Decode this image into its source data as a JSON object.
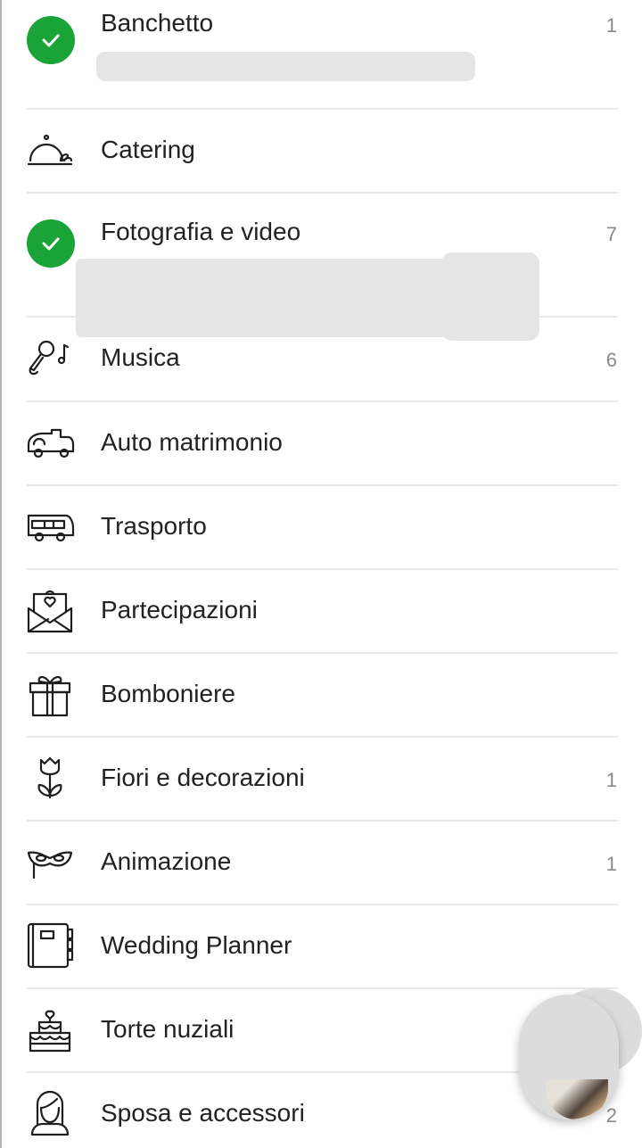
{
  "categories": [
    {
      "label": "Banchetto",
      "count": "1",
      "icon": "check-circle-icon",
      "completed": true
    },
    {
      "label": "Catering",
      "count": "",
      "icon": "cloche-icon",
      "completed": false
    },
    {
      "label": "Fotografia e video",
      "count": "7",
      "icon": "check-circle-icon",
      "completed": true
    },
    {
      "label": "Musica",
      "count": "6",
      "icon": "microphone-note-icon",
      "completed": false
    },
    {
      "label": "Auto matrimonio",
      "count": "",
      "icon": "car-icon",
      "completed": false
    },
    {
      "label": "Trasporto",
      "count": "",
      "icon": "bus-icon",
      "completed": false
    },
    {
      "label": "Partecipazioni",
      "count": "",
      "icon": "envelope-heart-icon",
      "completed": false
    },
    {
      "label": "Bomboniere",
      "count": "",
      "icon": "gift-icon",
      "completed": false
    },
    {
      "label": "Fiori e decorazioni",
      "count": "1",
      "icon": "tulip-icon",
      "completed": false
    },
    {
      "label": "Animazione",
      "count": "1",
      "icon": "mask-icon",
      "completed": false
    },
    {
      "label": "Wedding Planner",
      "count": "",
      "icon": "planner-book-icon",
      "completed": false
    },
    {
      "label": "Torte nuziali",
      "count": "",
      "icon": "cake-icon",
      "completed": false
    },
    {
      "label": "Sposa e accessori",
      "count": "2",
      "icon": "bride-icon",
      "completed": false
    }
  ],
  "colors": {
    "check_green": "#1aa336",
    "separator": "#e8e8e8",
    "count_gray": "#888888"
  }
}
